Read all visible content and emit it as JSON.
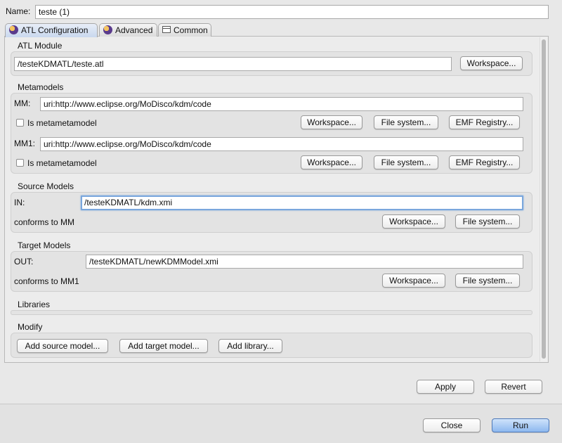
{
  "name": {
    "label": "Name:",
    "value": "teste (1)"
  },
  "tabs": [
    {
      "label": "ATL Configuration",
      "icon": "atl-icon"
    },
    {
      "label": "Advanced",
      "icon": "atl-icon"
    },
    {
      "label": "Common",
      "icon": "common-tab-icon"
    }
  ],
  "atl_module": {
    "title": "ATL Module",
    "path": "/testeKDMATL/teste.atl",
    "workspace": "Workspace..."
  },
  "metamodels": {
    "title": "Metamodels",
    "mm": {
      "label": "MM:",
      "value": "uri:http://www.eclipse.org/MoDisco/kdm/code",
      "checkbox": "Is metametamodel",
      "workspace": "Workspace...",
      "filesystem": "File system...",
      "emf": "EMF Registry..."
    },
    "mm1": {
      "label": "MM1:",
      "value": "uri:http://www.eclipse.org/MoDisco/kdm/code",
      "checkbox": "Is metametamodel",
      "workspace": "Workspace...",
      "filesystem": "File system...",
      "emf": "EMF Registry..."
    }
  },
  "source_models": {
    "title": "Source Models",
    "label": "IN:",
    "value": "/testeKDMATL/kdm.xmi",
    "conforms": "conforms to MM",
    "workspace": "Workspace...",
    "filesystem": "File system..."
  },
  "target_models": {
    "title": "Target Models",
    "label": "OUT:",
    "value": "/testeKDMATL/newKDMModel.xmi",
    "conforms": "conforms to MM1",
    "workspace": "Workspace...",
    "filesystem": "File system..."
  },
  "libraries": {
    "title": "Libraries"
  },
  "modify": {
    "title": "Modify",
    "add_source": "Add source model...",
    "add_target": "Add target model...",
    "add_library": "Add library..."
  },
  "footer": {
    "apply": "Apply",
    "revert": "Revert",
    "close": "Close",
    "run": "Run"
  },
  "colors": {
    "run_button": "#8db8ef",
    "focus_border": "#7aa7dd"
  }
}
